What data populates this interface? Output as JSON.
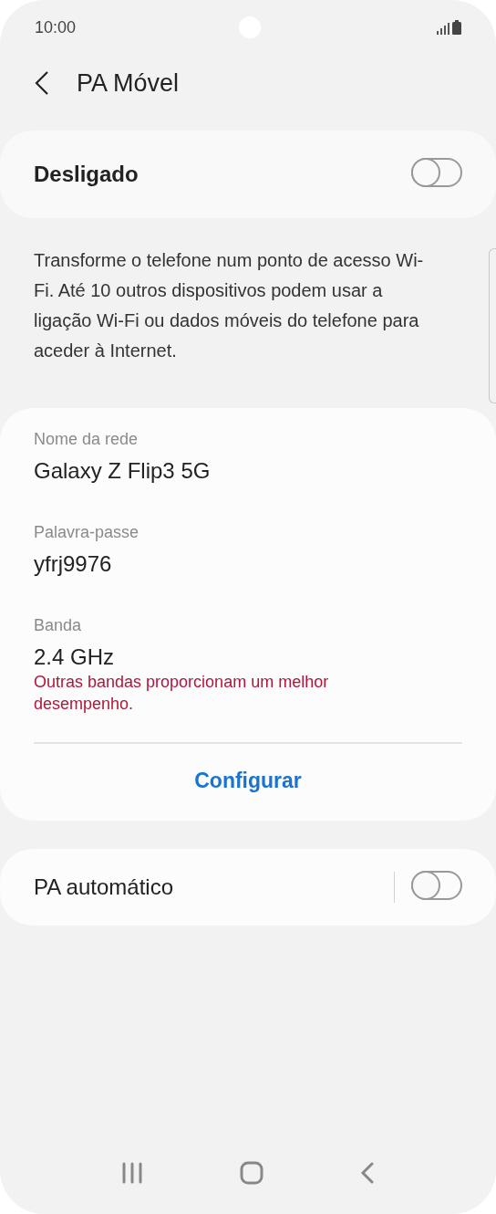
{
  "status_bar": {
    "time": "10:00"
  },
  "header": {
    "title": "PA Móvel"
  },
  "main_switch": {
    "label": "Desligado",
    "on": false
  },
  "description": "Transforme o telefone num ponto de acesso Wi-Fi. Até 10 outros dispositivos podem usar a ligação Wi-Fi ou dados móveis do telefone para aceder à Internet.",
  "details": [
    {
      "label": "Nome da rede",
      "value": "Galaxy Z Flip3 5G"
    },
    {
      "label": "Palavra-passe",
      "value": "yfrj9976"
    },
    {
      "label": "Banda",
      "value": "2.4 GHz",
      "warning": "Outras bandas proporcionam um melhor desempenho."
    }
  ],
  "configure_button": "Configurar",
  "auto_switch": {
    "label": "PA automático",
    "on": false
  }
}
